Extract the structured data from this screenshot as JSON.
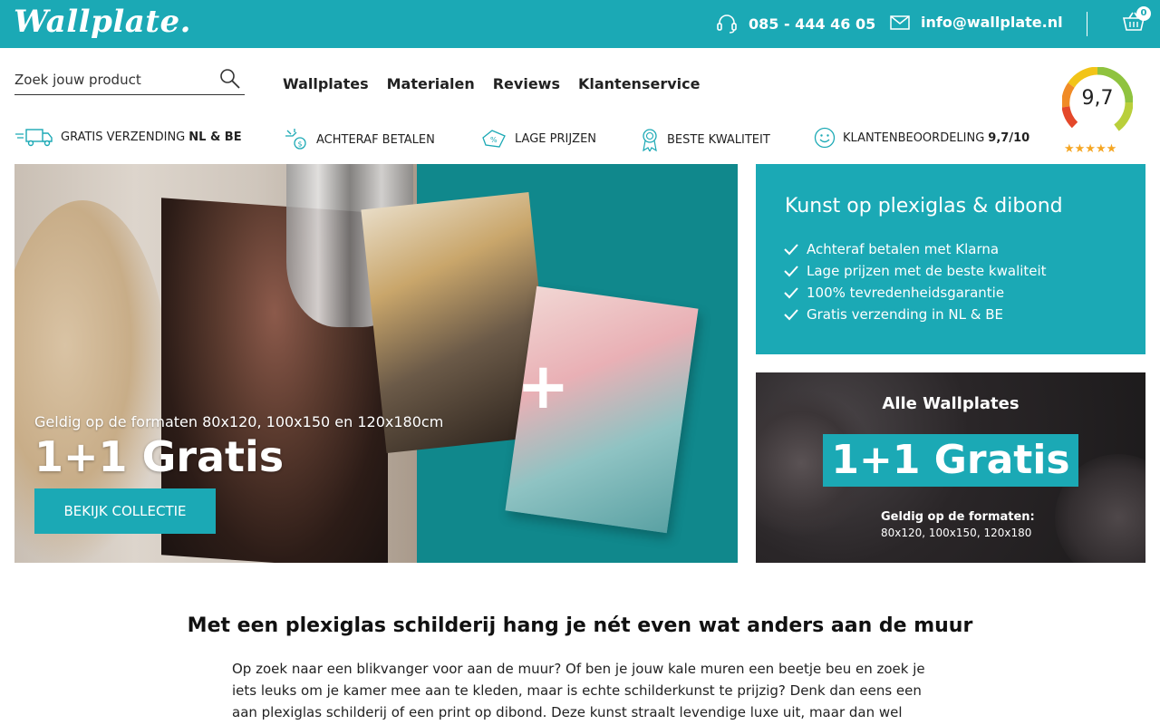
{
  "header": {
    "logo": "Wallplate.",
    "phone": "085 - 444 46 05",
    "email": "info@wallplate.nl",
    "cart_count": "0",
    "brand_color": "#1ba9b5"
  },
  "search": {
    "placeholder": "Zoek jouw product"
  },
  "nav": {
    "items": [
      "Wallplates",
      "Materialen",
      "Reviews",
      "Klantenservice"
    ]
  },
  "usps": [
    {
      "icon": "truck-icon",
      "label": "GRATIS VERZENDING",
      "bold": "NL & BE"
    },
    {
      "icon": "payment-hand-icon",
      "label": "ACHTERAF BETALEN",
      "bold": ""
    },
    {
      "icon": "discount-tag-icon",
      "label": "LAGE PRIJZEN",
      "bold": ""
    },
    {
      "icon": "award-ribbon-icon",
      "label": "BESTE KWALITEIT",
      "bold": ""
    },
    {
      "icon": "smiley-icon",
      "label": "KLANTENBEOORDELING",
      "bold": "9,7/10"
    }
  ],
  "rating": {
    "value": "9,7",
    "stars": "★★★★★"
  },
  "hero": {
    "subtitle": "Geldig op de formaten 80x120, 100x150 en 120x180cm",
    "title": "1+1 Gratis",
    "button": "BEKIJK COLLECTIE",
    "plus": "+"
  },
  "infobox": {
    "title": "Kunst op plexiglas & dibond",
    "items": [
      "Achteraf betalen met Klarna",
      "Lage prijzen met de beste kwaliteit",
      "100% tevredenheidsgarantie",
      "Gratis verzending in NL & BE"
    ]
  },
  "promo": {
    "title": "Alle Wallplates",
    "big": "1+1 Gratis",
    "line1": "Geldig op de formaten:",
    "line2": "80x120, 100x150, 120x180"
  },
  "content": {
    "title": "Met een plexiglas schilderij hang je nét even wat anders aan de muur",
    "text": "Op zoek naar een blikvanger voor aan de muur? Of ben je jouw kale muren een beetje beu en zoek je iets leuks om je kamer mee aan te kleden, maar is echte schilderkunst te prijzig? Denk dan eens een aan plexiglas schilderij of een print op dibond. Deze kunst straalt levendige luxe uit, maar dan wel voor"
  }
}
